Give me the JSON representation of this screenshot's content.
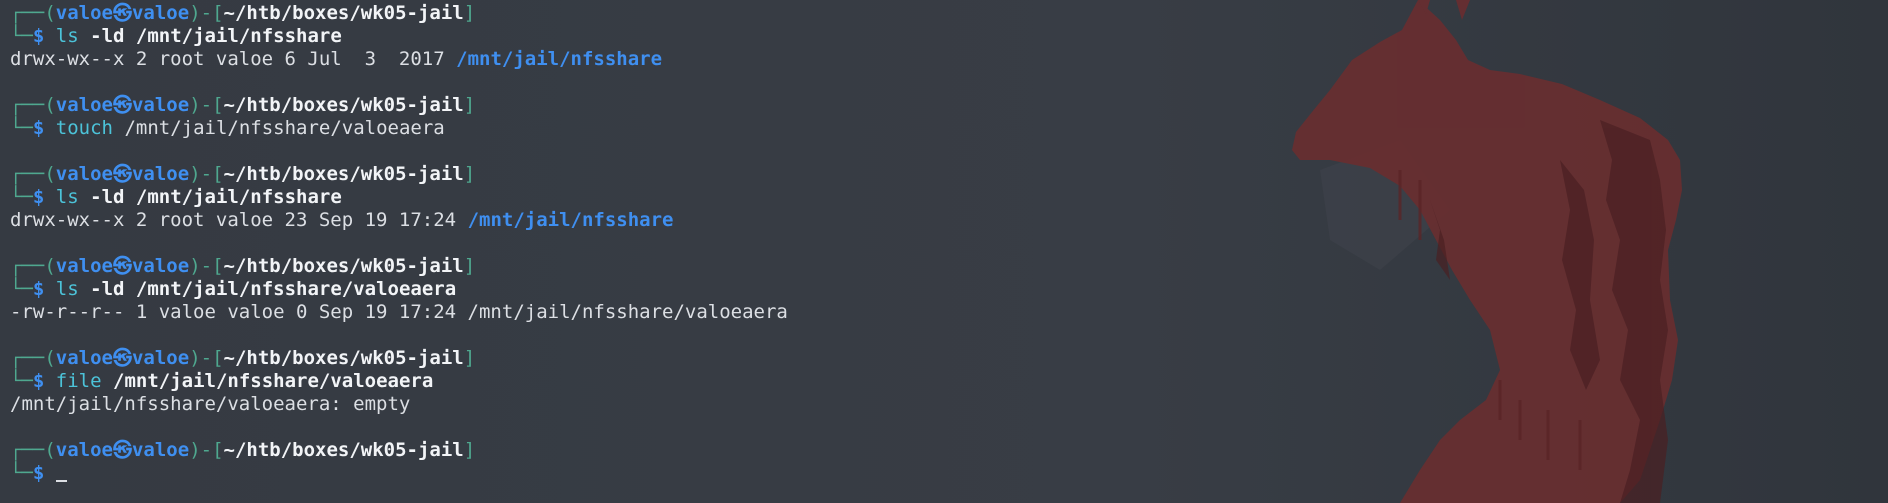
{
  "prompt": {
    "user": "valoe",
    "host": "valoe",
    "separator": "㉿",
    "cwd": "~/htb/boxes/wk05-jail",
    "top_prefix": "┌──(",
    "top_mid": ")-[",
    "top_suffix": "]",
    "bottom_prefix": "└─",
    "dollar": "$"
  },
  "blocks": [
    {
      "command": "ls",
      "args": "-ld /mnt/jail/nfsshare",
      "output": [
        {
          "text": "drwx-wx--x 2 root valoe 6 Jul  3  2017 ",
          "link": "/mnt/jail/nfsshare"
        }
      ]
    },
    {
      "command": "touch",
      "args": "/mnt/jail/nfsshare/valoeaera",
      "output": []
    },
    {
      "command": "ls",
      "args": "-ld /mnt/jail/nfsshare",
      "output": [
        {
          "text": "drwx-wx--x 2 root valoe 23 Sep 19 17:24 ",
          "link": "/mnt/jail/nfsshare"
        }
      ]
    },
    {
      "command": "ls",
      "args": "-ld /mnt/jail/nfsshare/valoeaera",
      "output": [
        {
          "text": "-rw-r--r-- 1 valoe valoe 0 Sep 19 17:24 /mnt/jail/nfsshare/valoeaera",
          "link": ""
        }
      ]
    },
    {
      "command": "file",
      "args": "/mnt/jail/nfsshare/valoeaera",
      "output": [
        {
          "text": "/mnt/jail/nfsshare/valoeaera: empty",
          "link": ""
        }
      ]
    }
  ],
  "colors": {
    "background": "#353a42",
    "prompt_frame": "#4fa88f",
    "user_host": "#3f8ff0",
    "command": "#4cc3d9",
    "directory": "#3f8ff0",
    "wallpaper_fox": "#6a2c2e"
  },
  "wallpaper": "red-fox-silhouette"
}
